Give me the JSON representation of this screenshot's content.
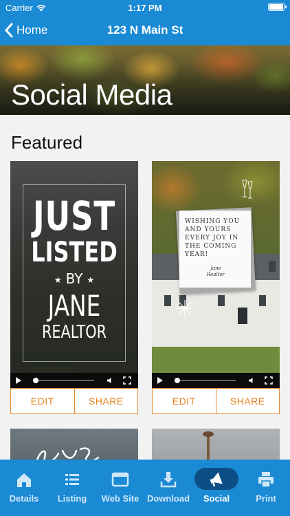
{
  "status_bar": {
    "carrier": "Carrier",
    "time": "1:17 PM"
  },
  "nav": {
    "back_label": "Home",
    "title": "123 N Main St"
  },
  "hero": {
    "title": "Social Media"
  },
  "featured": {
    "title": "Featured",
    "cards": [
      {
        "poster": {
          "line1": "JUST",
          "line2": "LISTED",
          "line3": "BY",
          "line4": "JANE",
          "line5": "REALTOR"
        },
        "edit_label": "EDIT",
        "share_label": "SHARE"
      },
      {
        "greeting": "WISHING YOU AND YOURS EVERY JOY IN THE COMING YEAR!",
        "signature_line1": "Jane",
        "signature_line2": "Realtor",
        "edit_label": "EDIT",
        "share_label": "SHARE"
      }
    ]
  },
  "tab_bar": {
    "active": "Social",
    "accent": "#1a8ad4",
    "active_pill": "#0c4f86",
    "tabs": [
      {
        "label": "Details",
        "icon": "home-icon"
      },
      {
        "label": "Listing",
        "icon": "list-icon"
      },
      {
        "label": "Web Site",
        "icon": "browser-window-icon"
      },
      {
        "label": "Download",
        "icon": "download-icon"
      },
      {
        "label": "Social",
        "icon": "megaphone-icon"
      },
      {
        "label": "Print",
        "icon": "printer-icon"
      }
    ]
  }
}
